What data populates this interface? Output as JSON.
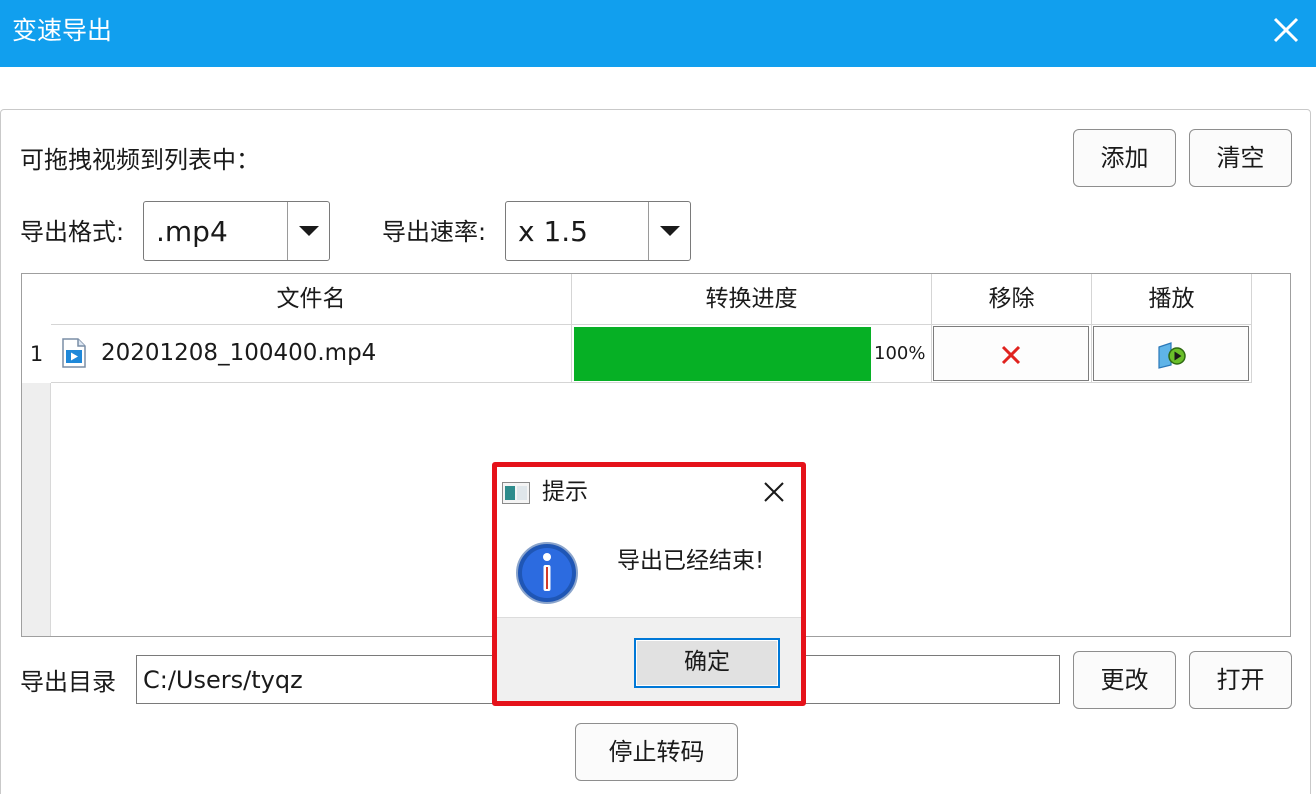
{
  "window": {
    "title": "变速导出",
    "titlebar_color": "#119fee"
  },
  "drag_hint": "可拖拽视频到列表中：",
  "buttons": {
    "add": "添加",
    "clear": "清空",
    "change": "更改",
    "open": "打开",
    "stop": "停止转码"
  },
  "format": {
    "label": "导出格式:",
    "value": ".mp4"
  },
  "speed": {
    "label": "导出速率:",
    "value": "x 1.5"
  },
  "table": {
    "headers": {
      "filename": "文件名",
      "progress": "转换进度",
      "remove": "移除",
      "play": "播放"
    },
    "rows": [
      {
        "index": "1",
        "filename": "20201208_100400.mp4",
        "progress_percent": 100,
        "progress_text": "100%",
        "progress_color": "#06b025"
      }
    ]
  },
  "output_dir": {
    "label": "导出目录",
    "value": "C:/Users/tyqz"
  },
  "dialog": {
    "title": "提示",
    "message": "导出已经结束!",
    "ok_label": "确定",
    "highlight_color": "#e5121a"
  }
}
